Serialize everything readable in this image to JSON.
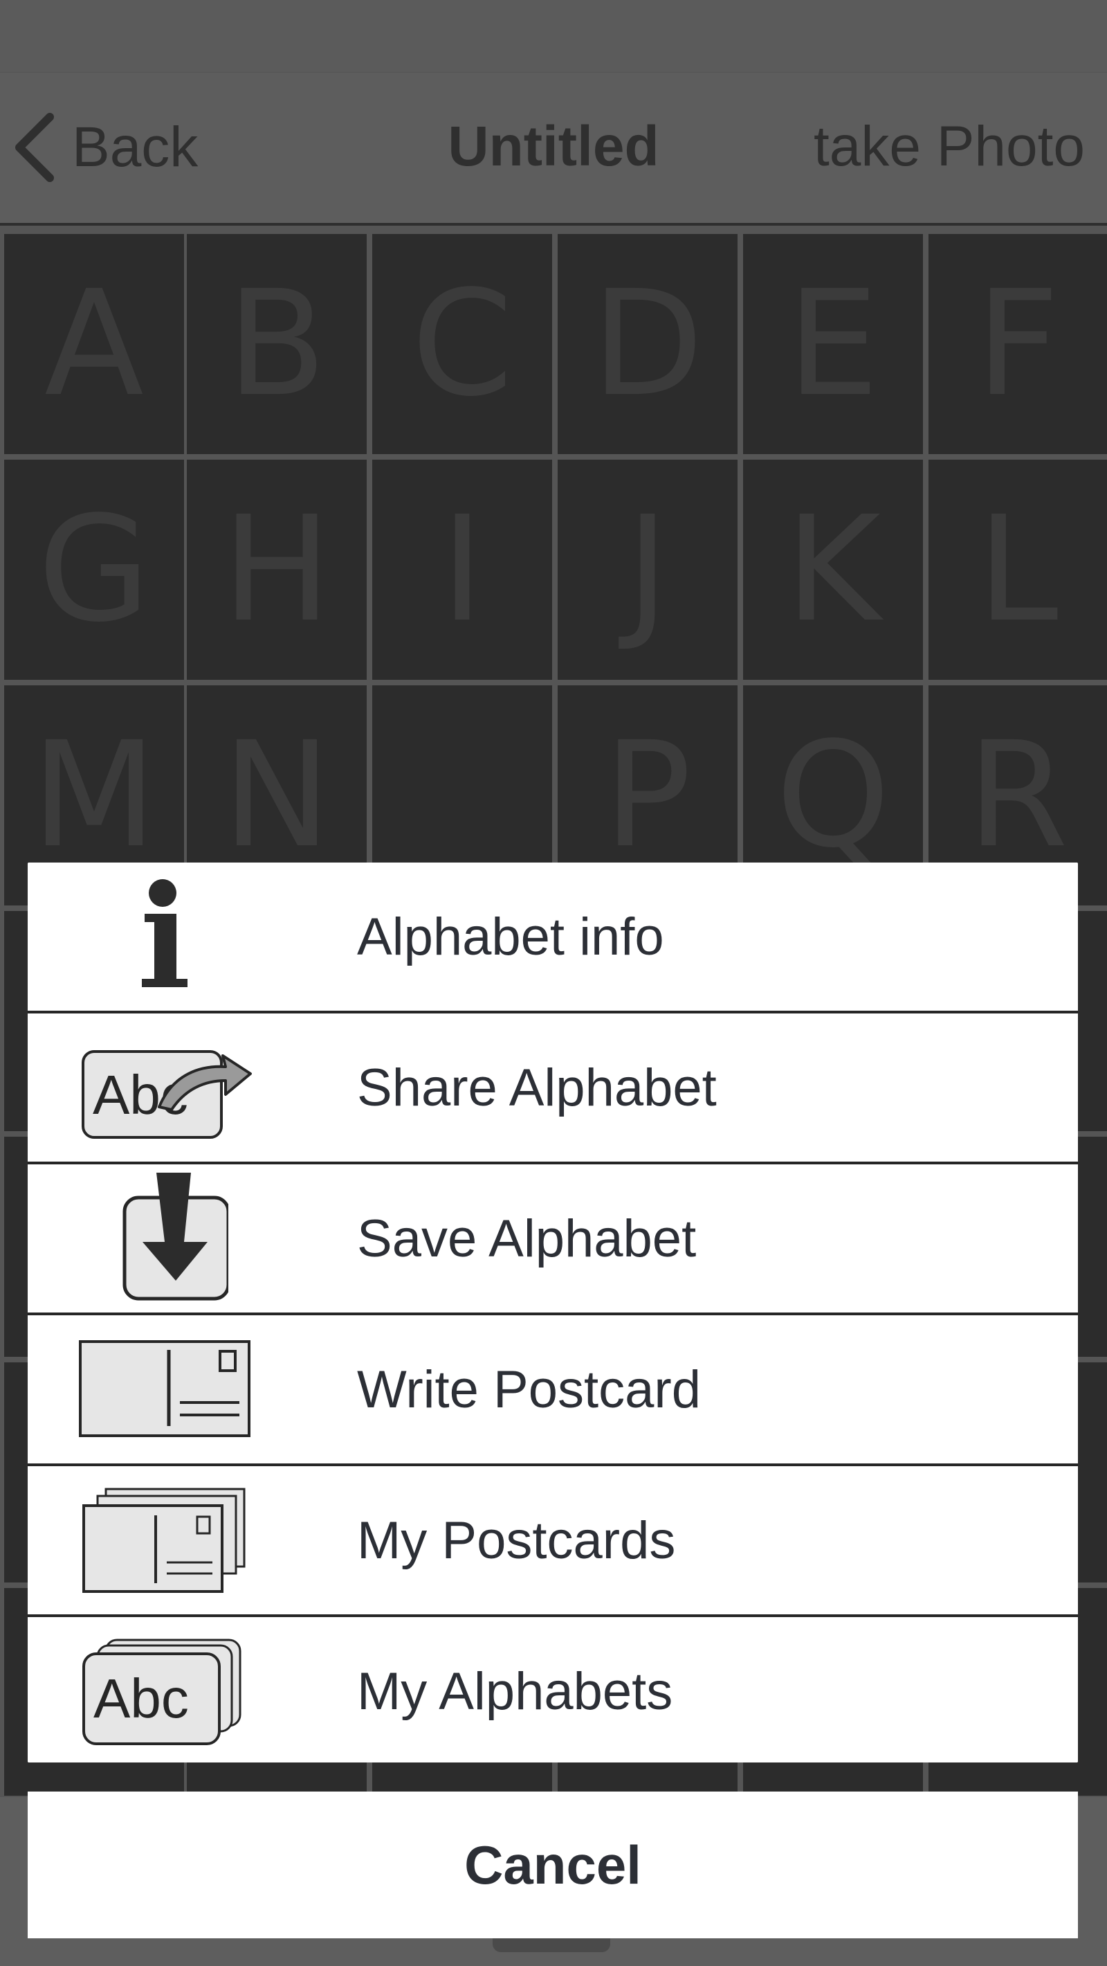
{
  "nav": {
    "back_label": "Back",
    "title": "Untitled",
    "right_label": "take Photo"
  },
  "grid_letters": [
    "A",
    "B",
    "C",
    "D",
    "E",
    "F",
    "G",
    "H",
    "I",
    "J",
    "K",
    "L",
    "M",
    "N",
    "",
    "P",
    "Q",
    "R"
  ],
  "sheet": {
    "items": [
      {
        "label": "Alphabet info",
        "icon": "info-icon"
      },
      {
        "label": "Share Alphabet",
        "icon": "share-alphabet-icon",
        "icon_text": "Abc"
      },
      {
        "label": "Save Alphabet",
        "icon": "save-icon"
      },
      {
        "label": "Write Postcard",
        "icon": "postcard-icon"
      },
      {
        "label": "My Postcards",
        "icon": "postcards-stack-icon"
      },
      {
        "label": "My Alphabets",
        "icon": "alphabets-stack-icon",
        "icon_text": "Abc"
      }
    ],
    "cancel_label": "Cancel"
  },
  "colors": {
    "overlay_bg": "#5a5a5a",
    "cell_bg": "#2c2c2c",
    "letter": "#3b3b3b",
    "sheet_text": "#2c2f36",
    "icon_fill": "#e6e6e6"
  }
}
